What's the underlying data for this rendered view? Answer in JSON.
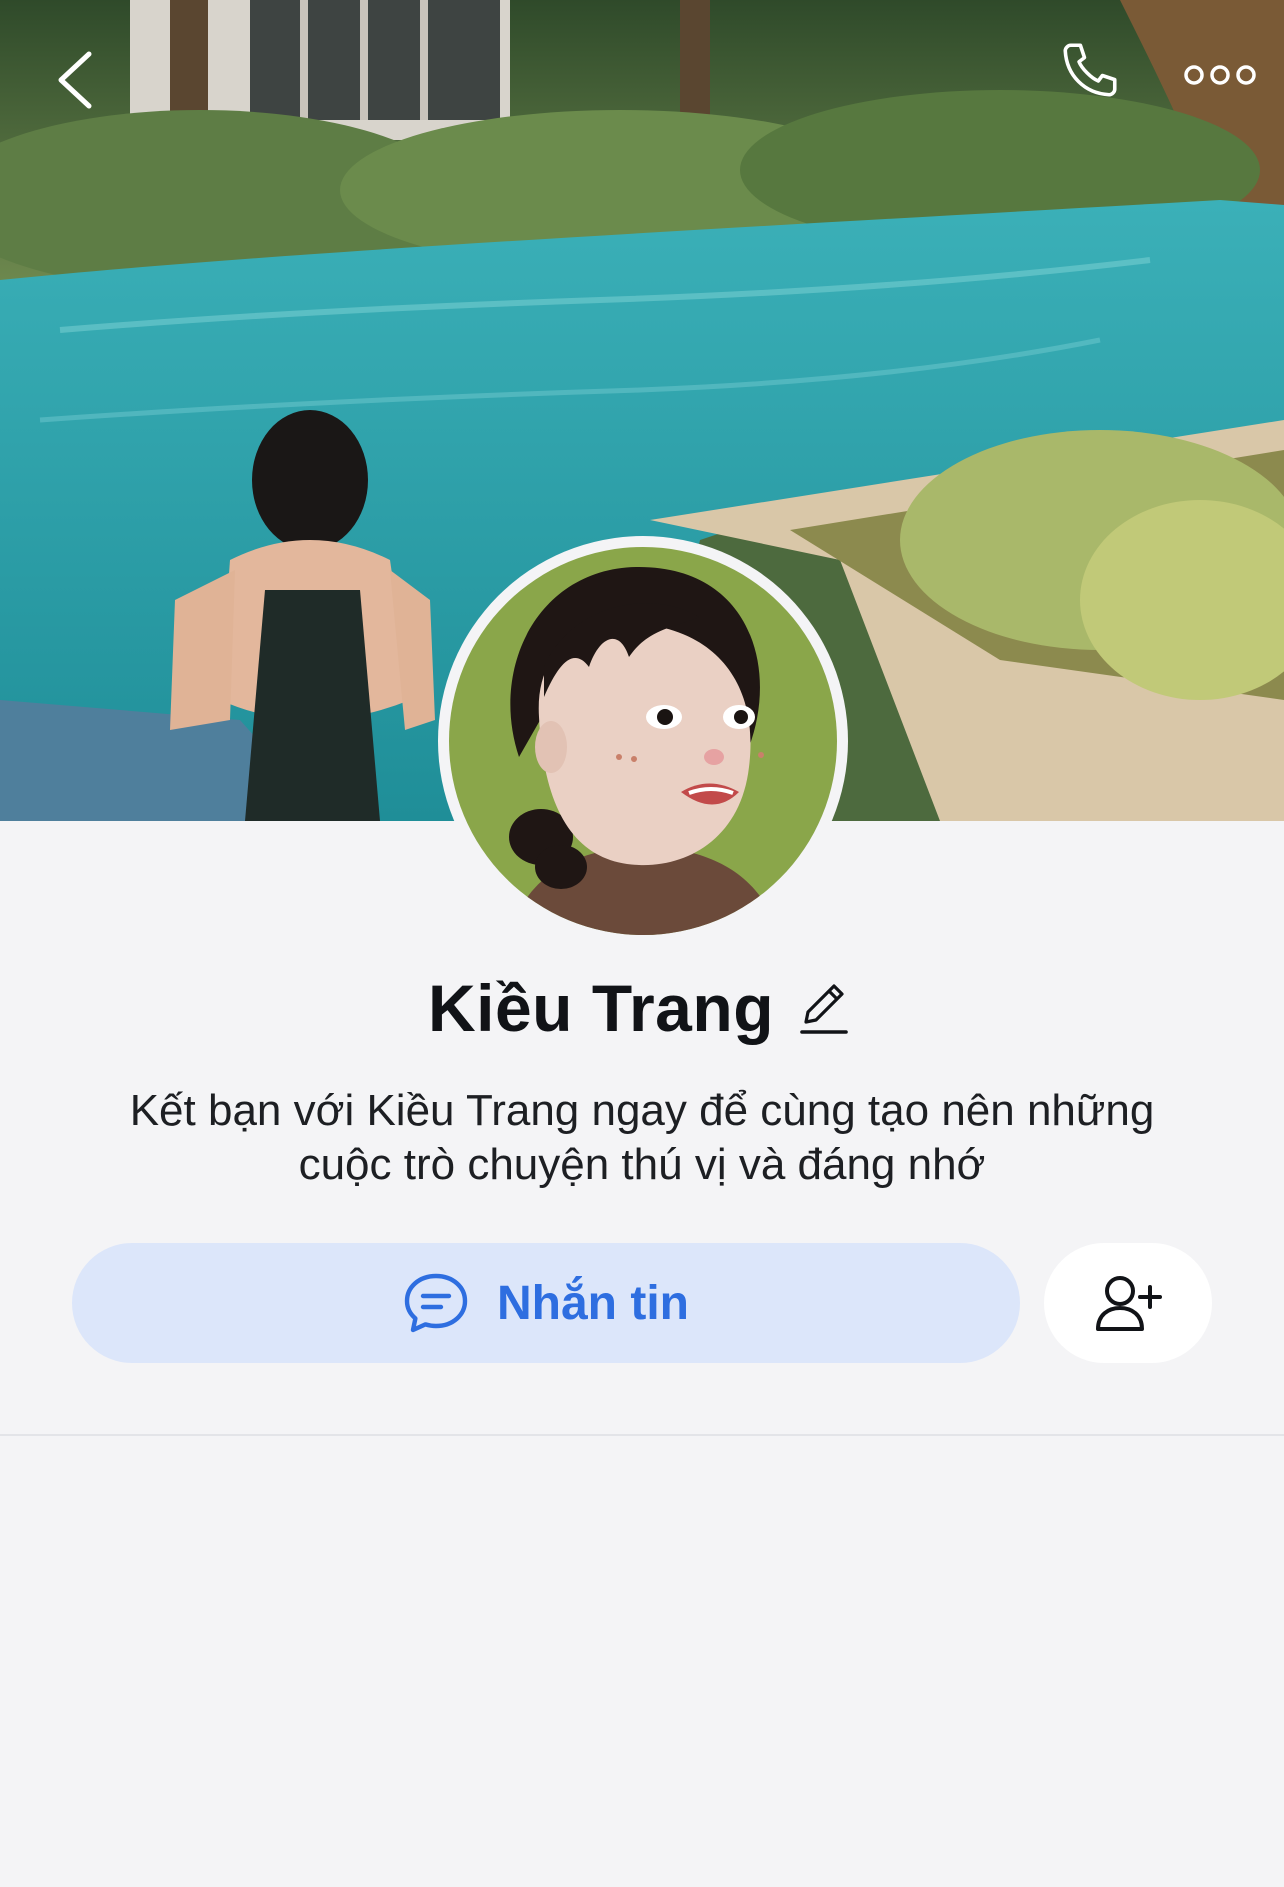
{
  "header": {
    "back_icon": "chevron-left-icon",
    "call_icon": "phone-icon",
    "more_icon": "more-horizontal-icon",
    "icon_color": "#ffffff"
  },
  "cover": {
    "description_icon": "cover-photo"
  },
  "profile": {
    "name": "Kiều Trang",
    "edit_icon": "pencil-icon",
    "bio": "Kết bạn với Kiều Trang ngay để cùng tạo nên những cuộc trò chuyện thú vị và đáng nhớ"
  },
  "actions": {
    "message_label": "Nhắn tin",
    "message_icon": "chat-bubble-icon",
    "add_friend_icon": "add-user-icon",
    "accent_color": "#2e6ee0",
    "message_bg": "#dce6fa"
  }
}
